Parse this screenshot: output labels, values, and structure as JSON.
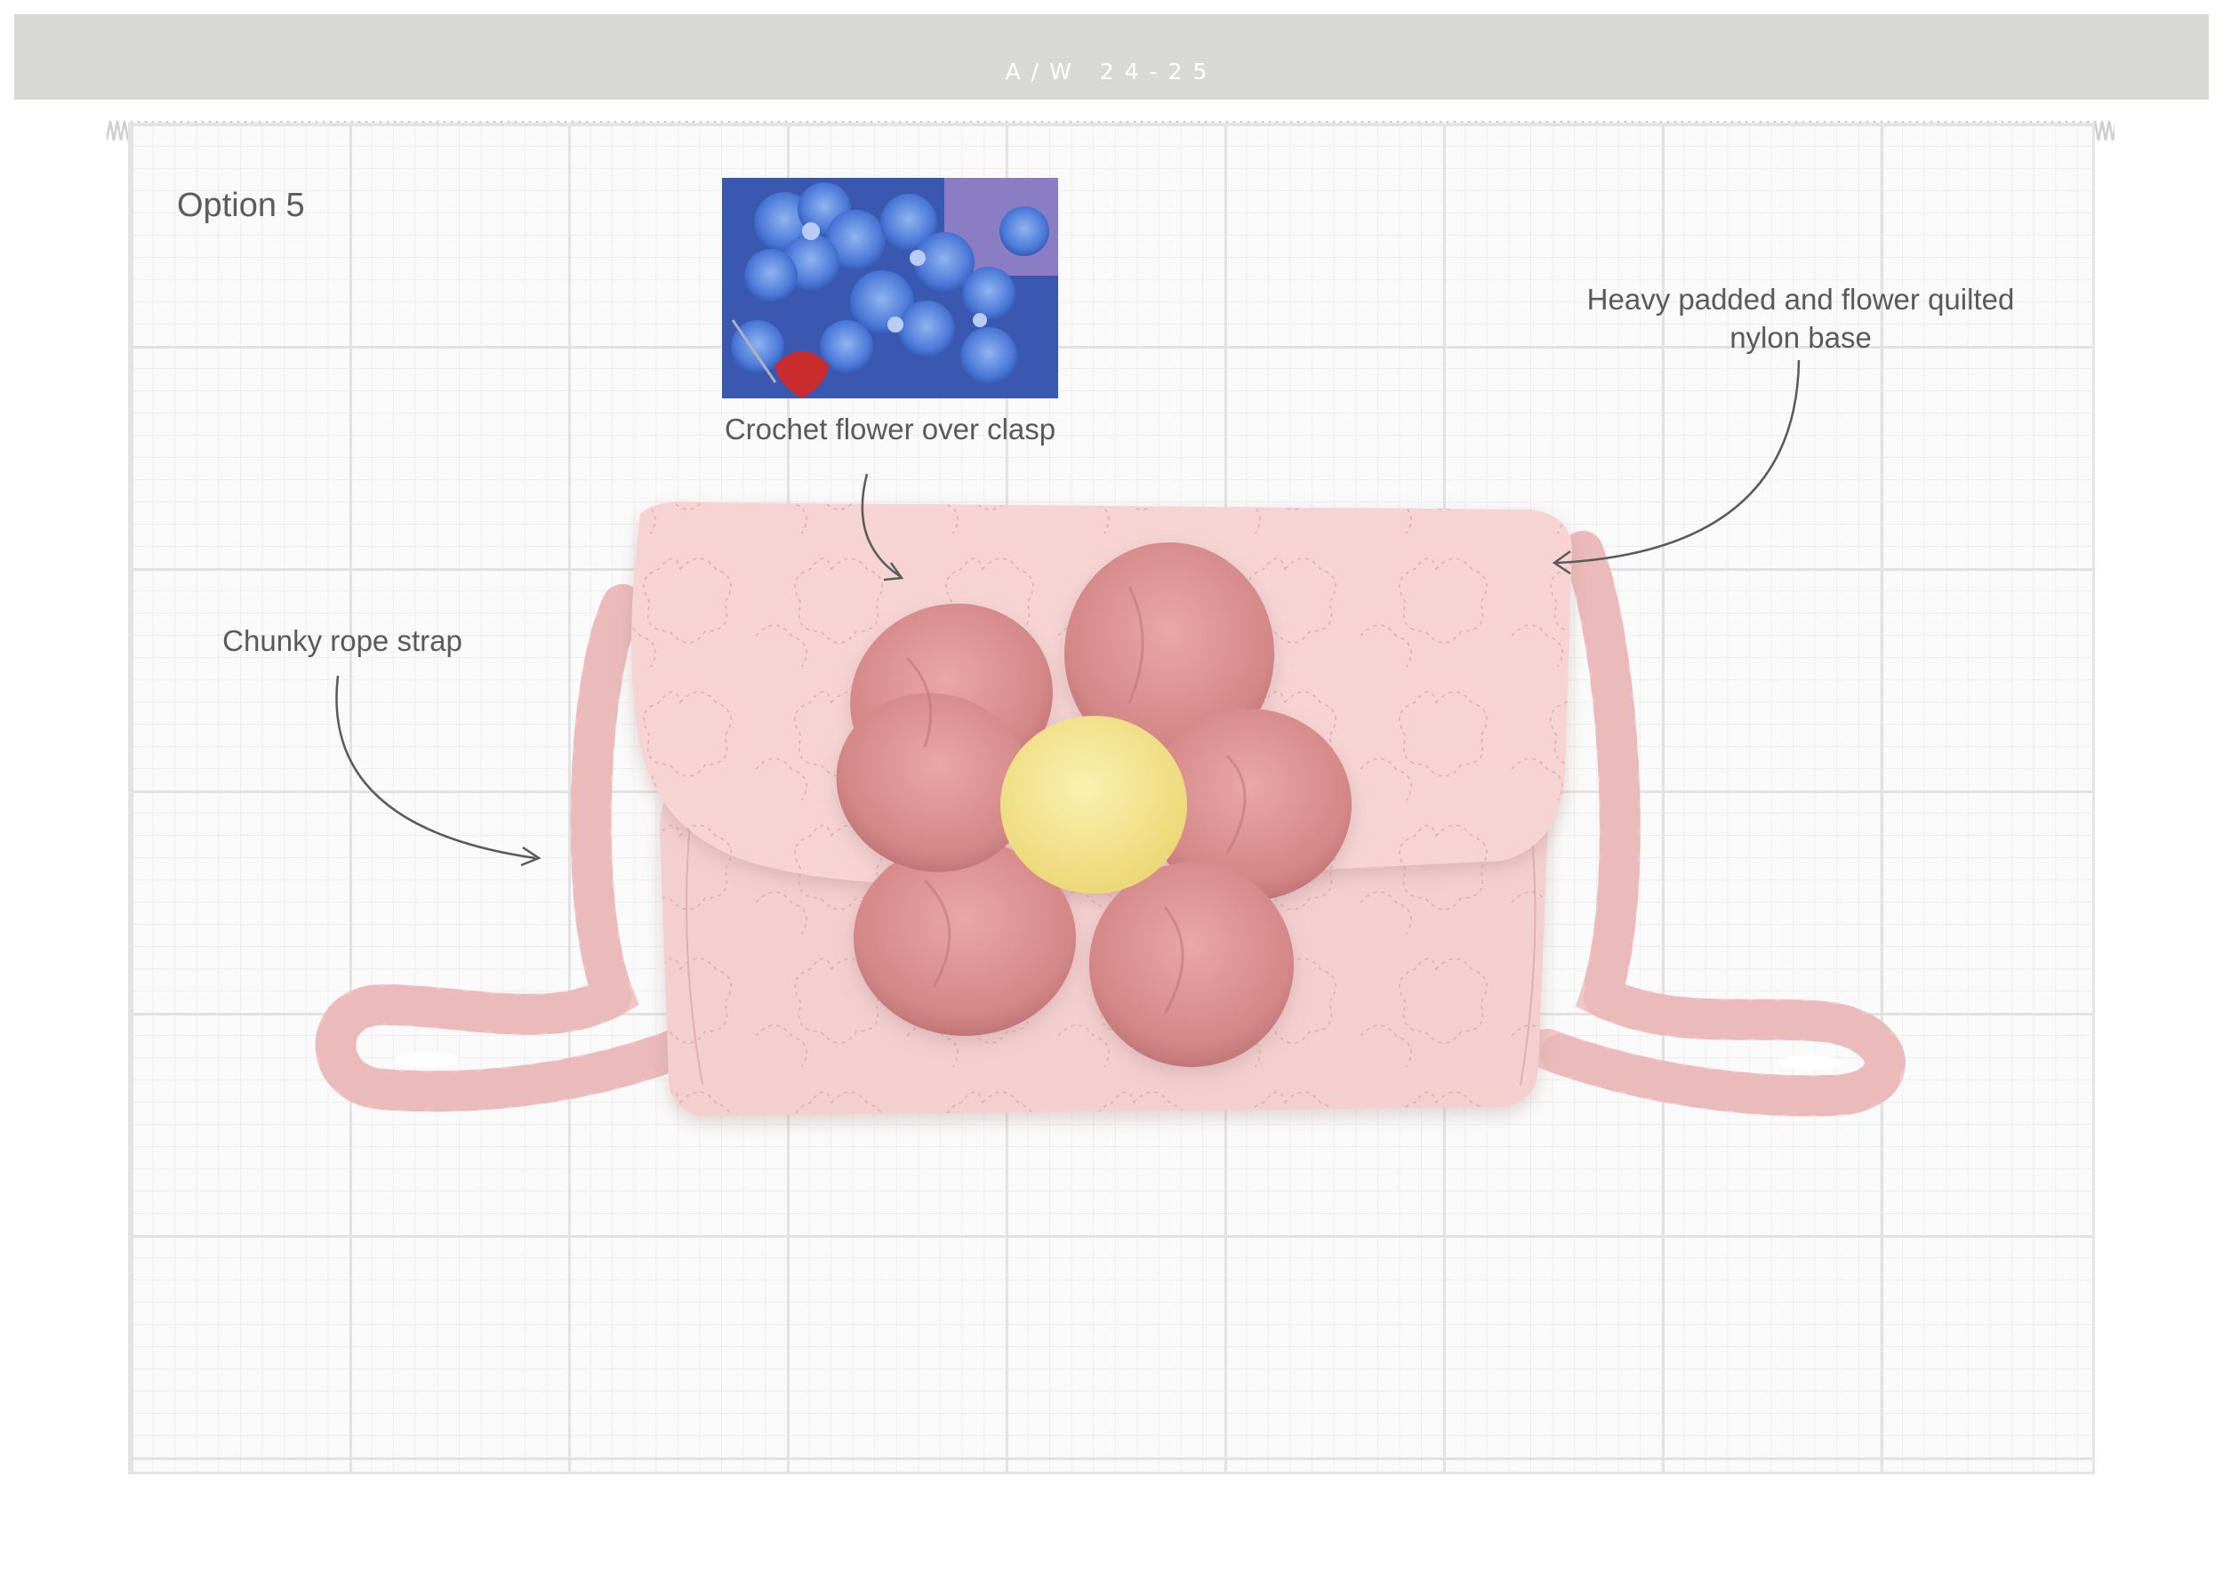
{
  "header": {
    "season_label": "A/W 24-25"
  },
  "board": {
    "option_title": "Option 5"
  },
  "callouts": {
    "crochet_flower": "Crochet flower over clasp",
    "rope_strap": "Chunky rope strap",
    "quilted_base_line1": "Heavy padded and flower quilted",
    "quilted_base_line2": "nylon base"
  },
  "colors": {
    "header_bar": "#d8d8d4",
    "bag_pink": "#f4cfcf",
    "flower_petal": "#d9898a",
    "flower_center": "#f4e58e",
    "reference_photo_blue": "#4a78d8"
  }
}
